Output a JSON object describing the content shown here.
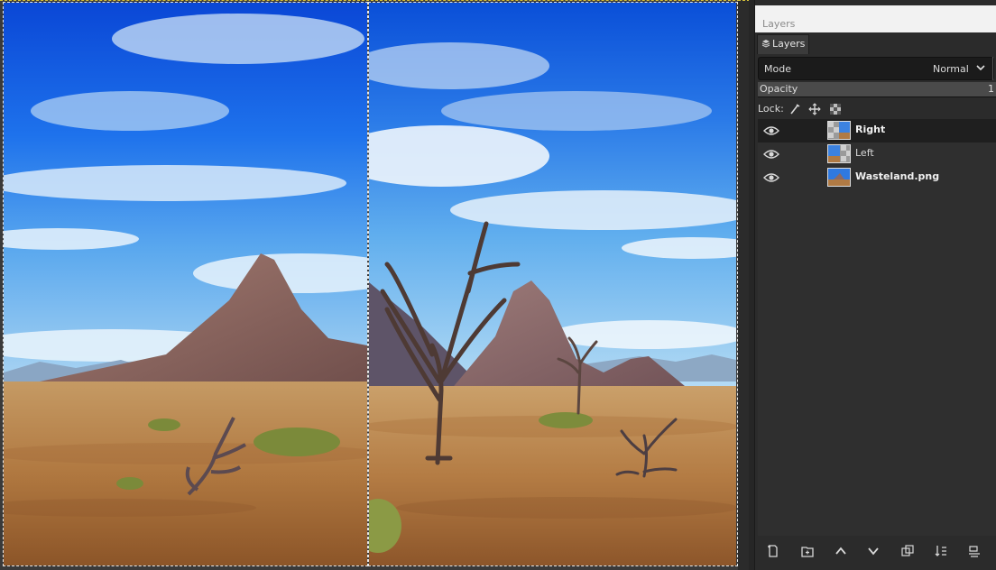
{
  "dock": {
    "title": "Layers",
    "tab_label": "Layers",
    "mode_label": "Mode",
    "mode_value": "Normal",
    "opacity_label": "Opacity",
    "opacity_value": "1",
    "lock_label": "Lock:",
    "lock_icons": [
      "lock-pixels-icon",
      "lock-position-icon",
      "lock-alpha-icon"
    ]
  },
  "layers": [
    {
      "name": "Right",
      "visible": true,
      "active": true,
      "bold": true
    },
    {
      "name": "Left",
      "visible": true,
      "active": false,
      "bold": false
    },
    {
      "name": "Wasteland.png",
      "visible": true,
      "active": false,
      "bold": true
    }
  ],
  "bottom_toolbar": [
    "new-layer-icon",
    "new-layer-group-icon",
    "raise-layer-icon",
    "lower-layer-icon",
    "duplicate-layer-icon",
    "merge-down-icon",
    "delete-layer-icon"
  ],
  "colors": {
    "sky_top": "#0a4fd8",
    "sky_bottom": "#6fb6f0",
    "ground": "#b8824c",
    "selection_marquee": "#e8e8e8",
    "image_boundary": "#d6c23a",
    "active_layer_bg": "#1f1f1f"
  }
}
